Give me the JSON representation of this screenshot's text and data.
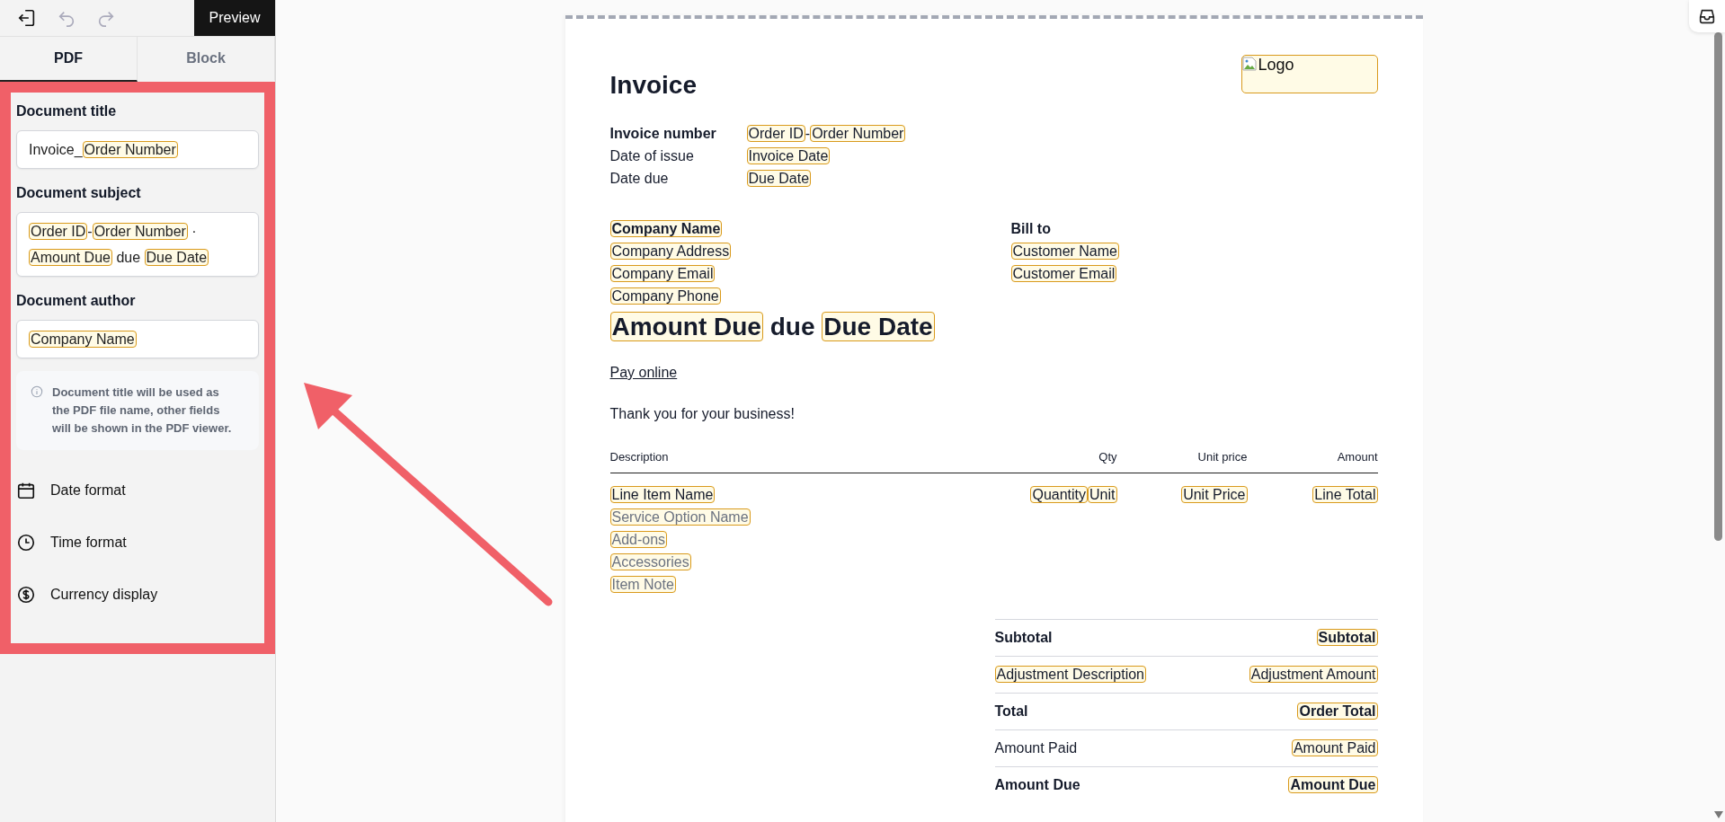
{
  "toolbar": {
    "preview_button": "Preview"
  },
  "tabs": [
    {
      "label": "PDF",
      "selected": true
    },
    {
      "label": "Block",
      "selected": false
    }
  ],
  "fields": [
    {
      "label": "Document title",
      "parts": [
        {
          "kind": "text",
          "text": "Invoice_"
        },
        {
          "kind": "token",
          "text": "Order Number"
        }
      ]
    },
    {
      "label": "Document subject",
      "parts": [
        {
          "kind": "token",
          "text": "Order ID"
        },
        {
          "kind": "text",
          "text": "-"
        },
        {
          "kind": "token",
          "text": "Order Number"
        },
        {
          "kind": "text",
          "text": " · "
        },
        {
          "kind": "token",
          "text": "Amount Due"
        },
        {
          "kind": "text",
          "text": " due "
        },
        {
          "kind": "token",
          "text": "Due Date"
        }
      ]
    },
    {
      "label": "Document author",
      "parts": [
        {
          "kind": "token",
          "text": "Company Name"
        }
      ]
    }
  ],
  "info_note": "Document title will be used as the PDF file name, other fields will be shown in the PDF viewer.",
  "settings": [
    {
      "label": "Date format",
      "kind": "calendar"
    },
    {
      "label": "Time format",
      "kind": "clock"
    },
    {
      "label": "Currency display",
      "kind": "dollar"
    }
  ],
  "invoice": {
    "title": "Invoice",
    "logo": "Logo",
    "meta": [
      {
        "label": "Invoice number",
        "bold": true,
        "parts": [
          {
            "kind": "token",
            "text": "Order ID"
          },
          {
            "kind": "text",
            "text": "-"
          },
          {
            "kind": "token",
            "text": "Order Number"
          }
        ]
      },
      {
        "label": "Date of issue",
        "bold": false,
        "parts": [
          {
            "kind": "token",
            "text": "Invoice Date"
          }
        ]
      },
      {
        "label": "Date due",
        "bold": false,
        "parts": [
          {
            "kind": "token",
            "text": "Due Date"
          }
        ]
      }
    ],
    "from": [
      {
        "text": "Company Name",
        "bold": true
      },
      {
        "text": "Company Address",
        "bold": false
      },
      {
        "text": "Company Email",
        "bold": false
      },
      {
        "text": "Company Phone",
        "bold": false
      }
    ],
    "bill_to": {
      "heading": "Bill to",
      "lines": [
        {
          "text": "Customer Name",
          "bold": false
        },
        {
          "text": "Customer Email",
          "bold": false
        }
      ]
    },
    "headline": [
      {
        "kind": "token",
        "text": "Amount Due"
      },
      {
        "kind": "text",
        "text": " due "
      },
      {
        "kind": "token",
        "text": "Due Date"
      }
    ],
    "pay_link": "Pay online",
    "thanks": "Thank you for your business!",
    "columns": [
      "Description",
      "Qty",
      "Unit price",
      "Amount"
    ],
    "item": {
      "description": [
        {
          "text": "Line Item Name",
          "muted": false
        },
        {
          "text": "Service Option Name",
          "muted": true
        },
        {
          "text": "Add-ons",
          "muted": true
        },
        {
          "text": "Accessories",
          "muted": true
        },
        {
          "text": "Item Note",
          "muted": true
        }
      ],
      "qty": [
        {
          "kind": "token",
          "text": "Quantity"
        },
        {
          "kind": "token",
          "text": "Unit"
        }
      ],
      "unit_price": [
        {
          "kind": "token",
          "text": "Unit Price"
        }
      ],
      "amount": [
        {
          "kind": "token",
          "text": "Line Total"
        }
      ]
    },
    "summary": [
      {
        "bold": true,
        "label": [
          {
            "kind": "text",
            "text": "Subtotal"
          }
        ],
        "value": [
          {
            "kind": "token",
            "text": "Subtotal"
          }
        ]
      },
      {
        "bold": false,
        "label": [
          {
            "kind": "token",
            "text": "Adjustment Description"
          }
        ],
        "value": [
          {
            "kind": "token",
            "text": "Adjustment Amount"
          }
        ]
      },
      {
        "bold": true,
        "label": [
          {
            "kind": "text",
            "text": "Total"
          }
        ],
        "value": [
          {
            "kind": "token",
            "text": "Order Total"
          }
        ]
      },
      {
        "bold": false,
        "label": [
          {
            "kind": "text",
            "text": "Amount Paid"
          }
        ],
        "value": [
          {
            "kind": "token",
            "text": "Amount Paid"
          }
        ]
      },
      {
        "bold": true,
        "label": [
          {
            "kind": "text",
            "text": "Amount Due"
          }
        ],
        "value": [
          {
            "kind": "token",
            "text": "Amount Due"
          }
        ]
      }
    ]
  }
}
